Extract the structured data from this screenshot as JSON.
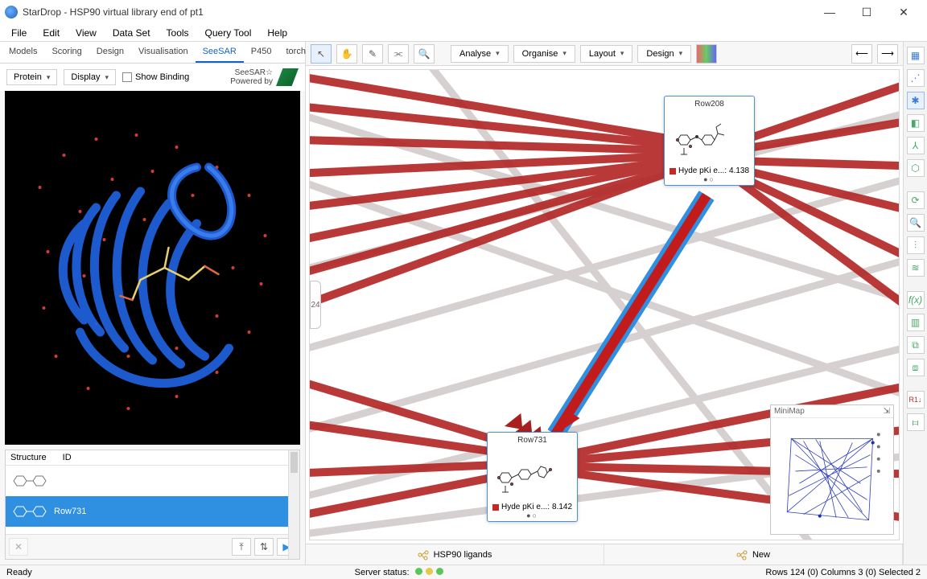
{
  "window": {
    "title": "StarDrop - HSP90 virtual library end of pt1"
  },
  "menu": [
    "File",
    "Edit",
    "View",
    "Data Set",
    "Tools",
    "Query Tool",
    "Help"
  ],
  "subtabs": {
    "items": [
      "Models",
      "Scoring",
      "Design",
      "Visualisation",
      "SeeSAR",
      "P450",
      "torch3D"
    ],
    "active": 4
  },
  "seesar": {
    "protein": "Protein",
    "display": "Display",
    "showBinding": "Show Binding",
    "brand1": "SeeSAR☆",
    "brand2": "Powered by"
  },
  "structPanel": {
    "cols": [
      "Structure",
      "ID"
    ],
    "rows": [
      {
        "id": "",
        "selected": false
      },
      {
        "id": "Row731",
        "selected": true
      }
    ]
  },
  "centerToolbar": {
    "analyse": "Analyse",
    "organise": "Organise",
    "layout": "Layout",
    "design": "Design"
  },
  "graph": {
    "node1": {
      "title": "Row208",
      "metric_label": "Hyde pKi e...:",
      "metric_value": "4.138"
    },
    "node2": {
      "title": "Row731",
      "metric_label": "Hyde pKi e...:",
      "metric_value": "8.142"
    },
    "clipLabel": "24",
    "minimap": "MiniMap"
  },
  "fileTabs": [
    "HSP90 ligands",
    "New"
  ],
  "status": {
    "ready": "Ready",
    "server": "Server status:",
    "rows": "Rows 124 (0) Columns 3 (0) Selected 2"
  }
}
